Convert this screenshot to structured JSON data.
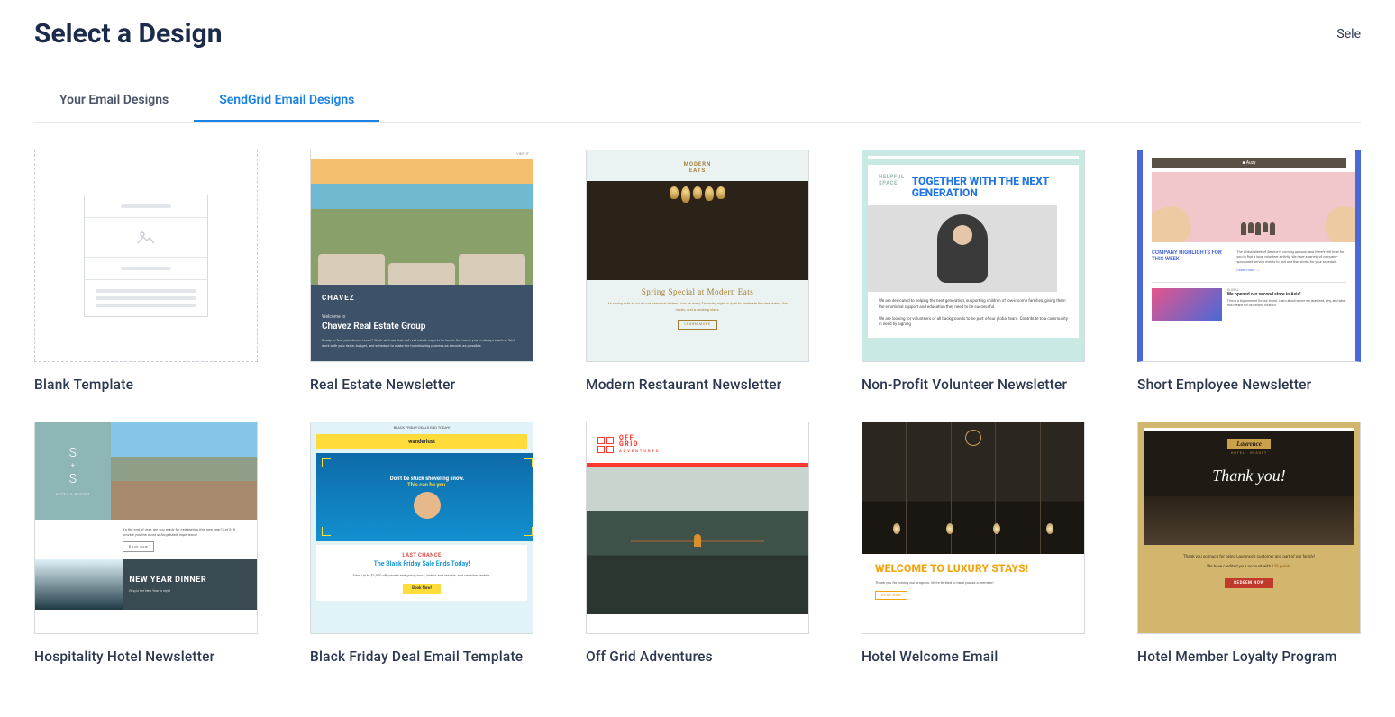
{
  "header": {
    "title": "Select a Design",
    "right_text": "Sele"
  },
  "tabs": [
    {
      "label": "Your Email Designs",
      "active": false
    },
    {
      "label": "SendGrid Email Designs",
      "active": true
    }
  ],
  "templates": [
    {
      "title": "Blank Template",
      "kind": "blank"
    },
    {
      "title": "Real Estate Newsletter",
      "kind": "realestate",
      "header_tag": "VIEW IT",
      "brand": "CHAVEZ",
      "welcome": "Welcome to",
      "headline": "Chavez Real Estate Group",
      "copy": "Ready to find your dream home? Work with our team of real estate experts to locate the home you've always wanted. We'll work with your taste, budget, and schedule to make the homebuying process as smooth as possible."
    },
    {
      "title": "Modern Restaurant Newsletter",
      "kind": "restaurant",
      "logo_top": "MODERN",
      "logo_bottom": "EATS",
      "headline": "Spring Special at Modern Eats",
      "copy": "As spring rolls in, so do our seasonal dishes. Join us every Thursday night in April to celebrate the new menu, live music, and a cooking class.",
      "cta": "LEARN MORE"
    },
    {
      "title": "Non-Profit Volunteer Newsletter",
      "kind": "nonprofit",
      "brand_top": "HELPFUL",
      "brand_bottom": "SPACE",
      "headline": "TOGETHER WITH THE NEXT GENERATION",
      "copy1": "We are dedicated to helping the next generation, supporting children of low-income families, giving them the emotional support and education they need to be successful.",
      "copy2": "We are looking for volunteers of all backgrounds to be part of our global team. Contribute to a community in need by signing"
    },
    {
      "title": "Short Employee Newsletter",
      "kind": "employee",
      "logo": "Auzy",
      "col_headline": "COMPANY HIGHLIGHTS FOR THIS WEEK",
      "col_copy": "The Global Week of Service is coming up soon, and there's still time for you to find a local volunteer activity. We have a variety of company-sponsored service events to find one that works for your schedule.",
      "link": "Learn more →",
      "tag": "GLOBAL",
      "row2_headline": "We opened our second store in Asia!",
      "row2_copy": "This is a big moment for our brand. Learn about where we launched, why, and what this means for us moving forward."
    },
    {
      "title": "Hospitality Hotel Newsletter",
      "kind": "hospitality",
      "side_s1": "S",
      "side_plus": "+",
      "side_s2": "S",
      "side_cap": "HOTEL & RESORT",
      "copy": "It's the end of year, are you ready for celebrating this new year? Let S+S provide you the most unforgettable experience!",
      "cta": "Book now",
      "strip_headline": "NEW YEAR DINNER",
      "strip_sub": "Ring in the New Year in style!"
    },
    {
      "title": "Black Friday Deal Email Template",
      "kind": "blackfriday",
      "topbar": "BLACK FRIDAY DEALS END TODAY!",
      "brand": "wanderlust",
      "hero_line1": "Don't be stuck shoveling snow.",
      "hero_line2": "This can be you.",
      "lastchance": "LAST CHANCE",
      "headline": "The Black Friday Sale Ends Today!",
      "copy": "Save Up to $1,000 off private and group tours, hotels and resorts, and vacation rentals.",
      "cta": "Book Now!"
    },
    {
      "title": "Off Grid Adventures",
      "kind": "offgrid",
      "logo_l1": "OFF",
      "logo_l2": "GRID",
      "logo_l3": "ADVENTURES"
    },
    {
      "title": "Hotel Welcome Email",
      "kind": "welcome",
      "headline": "WELCOME TO LUXURY STAYS!",
      "copy": "Thank you for joining our program. We're thrilled to have you as a member!",
      "cta": "Book Now"
    },
    {
      "title": "Hotel Member Loyalty Program",
      "kind": "loyalty",
      "brand": "Laurence",
      "brand_sub": "HOTEL · RESORT",
      "thankyou": "Thank you!",
      "copy1": "Thank you so much for being Laurence's customer and part of our family!",
      "copy2_a": "We have credited your account with ",
      "copy2_b": "125 points",
      "cta": "REDEEM NOW"
    }
  ]
}
